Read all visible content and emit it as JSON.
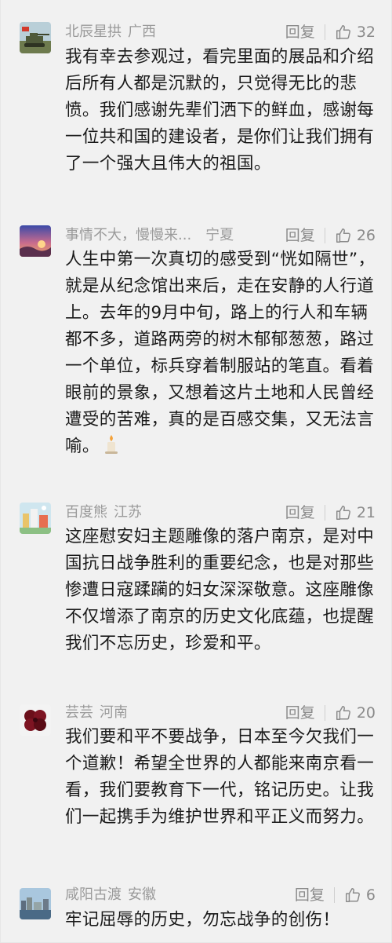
{
  "comments": [
    {
      "user": "北辰星拱",
      "region": "广西",
      "reply_label": "回复",
      "likes": "32",
      "text": "我有幸去参观过，看完里面的展品和介绍后所有人都是沉默的，只觉得无比的悲愤。我们感谢先辈们洒下的鲜血，感谢每一位共和国的建设者，是你们让我们拥有了一个强大且伟大的祖国。",
      "avatar_icon": "tank-avatar-icon"
    },
    {
      "user": "事情不大，慢慢来...",
      "region": "宁夏",
      "reply_label": "回复",
      "likes": "26",
      "text": "人生中第一次真切的感受到“恍如隔世”，就是从纪念馆出来后，走在安静的人行道上。去年的9月中旬，路上的行人和车辆都不多，道路两旁的树木郁郁葱葱，路过一个单位，标兵穿着制服站的笔直。看着眼前的景象，又想着这片土地和人民曾经遭受的苦难，真的是百感交集，又无法言喻。",
      "emoji": "candle-emoji",
      "avatar_icon": "sunset-avatar-icon"
    },
    {
      "user": "百度熊",
      "region": "江苏",
      "reply_label": "回复",
      "likes": "21",
      "text": "这座慰安妇主题雕像的落户南京，是对中国抗日战争胜利的重要纪念，也是对那些惨遭日寇蹂躏的妇女深深敬意。这座雕像不仅增添了南京的历史文化底蕴，也提醒我们不忘历史，珍爱和平。",
      "avatar_icon": "city-avatar-icon"
    },
    {
      "user": "芸芸",
      "region": "河南",
      "reply_label": "回复",
      "likes": "20",
      "text": "我们要和平不要战争，日本至今欠我们一个道歉！希望全世界的人都能来南京看一看，我们要教育下一代，铭记历史。让我们一起携手为维护世界和平正义而努力。",
      "avatar_icon": "flower-avatar-icon"
    },
    {
      "user": "咸阳古渡",
      "region": "安徽",
      "reply_label": "回复",
      "likes": "6",
      "text": "牢记屈辱的历史，勿忘战争的创伤！",
      "avatar_icon": "harbor-avatar-icon"
    }
  ],
  "colors": {
    "meta": "#9a9a9a",
    "text": "#1a1a1a",
    "background": "#f1f1f1"
  }
}
